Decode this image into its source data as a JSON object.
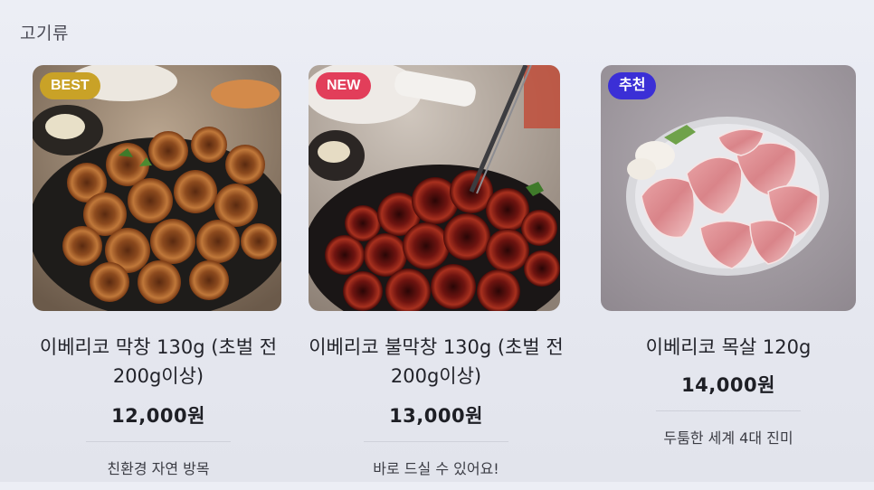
{
  "category": {
    "title": "고기류"
  },
  "products": [
    {
      "badge": "BEST",
      "badge_color": "#c9a227",
      "name": "이베리코 막창 130g (초벌 전\n200g이상)",
      "price": "12,000원",
      "description": "친환경 자연 방목",
      "image_icon": "grilled-intestine-image"
    },
    {
      "badge": "NEW",
      "badge_color": "#e23e5a",
      "name": "이베리코 불막창 130g (초벌 전\n200g이상)",
      "price": "13,000원",
      "description": "바로 드실 수 있어요!",
      "image_icon": "spicy-intestine-image"
    },
    {
      "badge": "추천",
      "badge_color": "#3b2fd6",
      "name": "이베리코 목살 120g",
      "price": "14,000원",
      "description": "두툼한 세계 4대 진미",
      "image_icon": "raw-pork-neck-image"
    }
  ]
}
